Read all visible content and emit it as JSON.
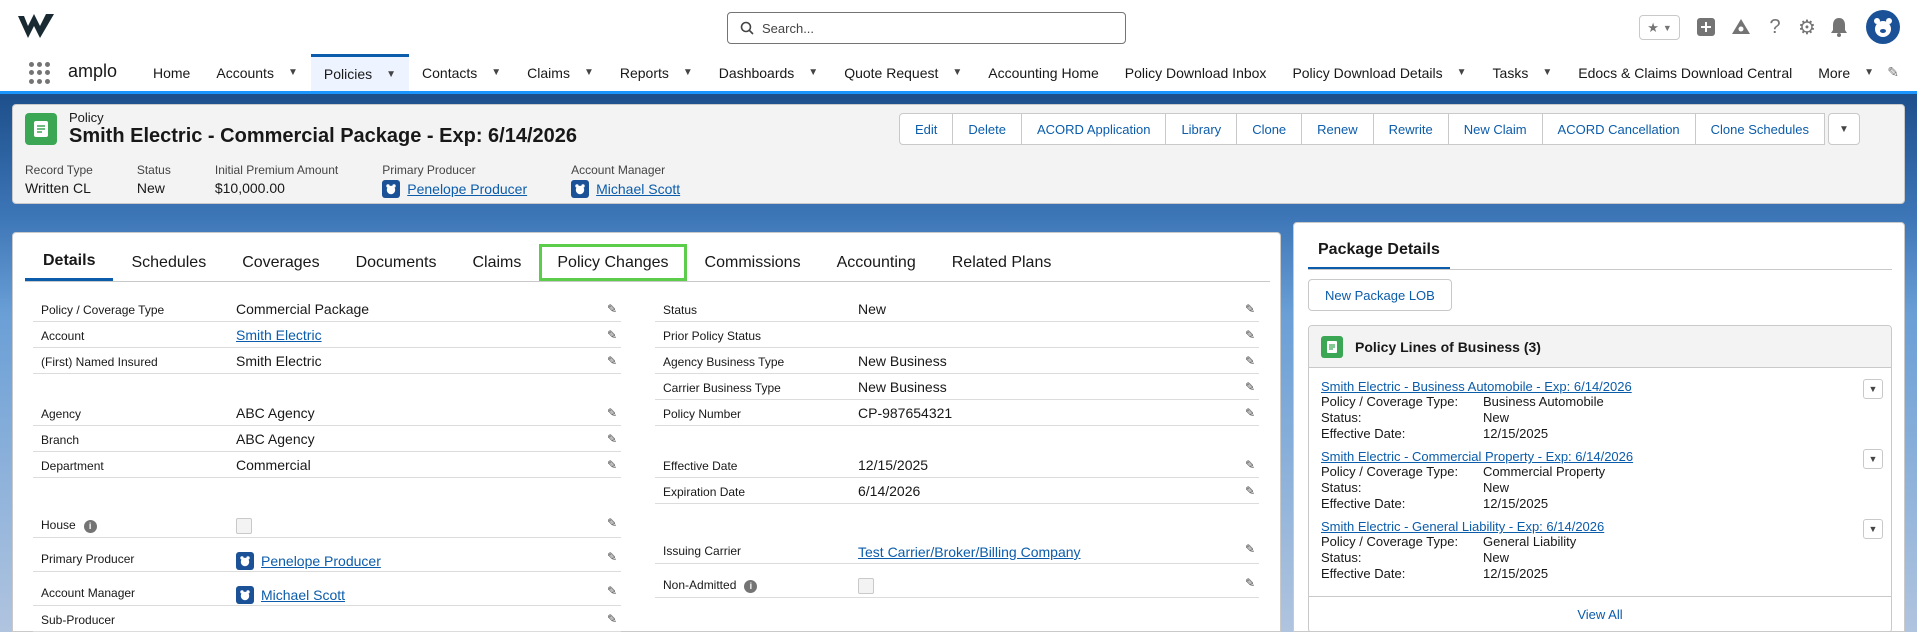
{
  "search": {
    "placeholder": "Search..."
  },
  "app": {
    "name": "amplo"
  },
  "nav": {
    "items": [
      {
        "label": "Home",
        "chevron": false
      },
      {
        "label": "Accounts",
        "chevron": true
      },
      {
        "label": "Policies",
        "chevron": true,
        "active": true
      },
      {
        "label": "Contacts",
        "chevron": true
      },
      {
        "label": "Claims",
        "chevron": true
      },
      {
        "label": "Reports",
        "chevron": true
      },
      {
        "label": "Dashboards",
        "chevron": true
      },
      {
        "label": "Quote Request",
        "chevron": true
      },
      {
        "label": "Accounting Home",
        "chevron": false
      },
      {
        "label": "Policy Download Inbox",
        "chevron": false
      },
      {
        "label": "Policy Download Details",
        "chevron": true
      },
      {
        "label": "Tasks",
        "chevron": true
      },
      {
        "label": "Edocs & Claims Download Central",
        "chevron": false
      },
      {
        "label": "More",
        "chevron": true
      }
    ]
  },
  "record": {
    "object": "Policy",
    "title": "Smith Electric - Commercial Package - Exp: 6/14/2026",
    "actions": [
      "Edit",
      "Delete",
      "ACORD Application",
      "Library",
      "Clone",
      "Renew",
      "Rewrite",
      "New Claim",
      "ACORD Cancellation",
      "Clone Schedules"
    ],
    "highlights": [
      {
        "label": "Record Type",
        "value": "Written CL",
        "user": false
      },
      {
        "label": "Status",
        "value": "New",
        "user": false
      },
      {
        "label": "Initial Premium Amount",
        "value": "$10,000.00",
        "user": false
      },
      {
        "label": "Primary Producer",
        "value": "Penelope Producer",
        "user": true
      },
      {
        "label": "Account Manager",
        "value": "Michael Scott",
        "user": true
      }
    ]
  },
  "tabs": [
    "Details",
    "Schedules",
    "Coverages",
    "Documents",
    "Claims",
    "Policy Changes",
    "Commissions",
    "Accounting",
    "Related Plans"
  ],
  "details": {
    "left": [
      {
        "label": "Policy / Coverage Type",
        "value": "Commercial Package"
      },
      {
        "label": "Account",
        "value": "Smith Electric",
        "link": true
      },
      {
        "label": "(First) Named Insured",
        "value": "Smith Electric",
        "gap": true
      },
      {
        "label": "Agency",
        "value": "ABC Agency"
      },
      {
        "label": "Branch",
        "value": "ABC Agency"
      },
      {
        "label": "Department",
        "value": "Commercial",
        "gap": true
      },
      {
        "label": "House",
        "value": "",
        "checkbox": true,
        "info": true
      },
      {
        "label": "Primary Producer",
        "value": "Penelope Producer",
        "link": true,
        "user": true
      },
      {
        "label": "Account Manager",
        "value": "Michael Scott",
        "link": true,
        "user": true
      },
      {
        "label": "Sub-Producer",
        "value": ""
      }
    ],
    "right": [
      {
        "label": "Status",
        "value": "New"
      },
      {
        "label": "Prior Policy Status",
        "value": ""
      },
      {
        "label": "Agency Business Type",
        "value": "New Business"
      },
      {
        "label": "Carrier Business Type",
        "value": "New Business"
      },
      {
        "label": "Policy Number",
        "value": "CP-987654321",
        "gap": true
      },
      {
        "label": "Effective Date",
        "value": "12/15/2025"
      },
      {
        "label": "Expiration Date",
        "value": "6/14/2026",
        "gap": true
      },
      {
        "label": "Issuing Carrier",
        "value": "Test Carrier/Broker/Billing Company",
        "link": true
      },
      {
        "label": "Non-Admitted",
        "value": "",
        "checkbox": true,
        "info": true
      }
    ]
  },
  "package": {
    "tab": "Package Details",
    "new_button": "New Package LOB",
    "card_title": "Policy Lines of Business (3)",
    "field_labels": {
      "type": "Policy / Coverage Type:",
      "status": "Status:",
      "effective": "Effective Date:"
    },
    "lines": [
      {
        "name": "Smith Electric - Business Automobile - Exp: 6/14/2026",
        "type": "Business Automobile",
        "status": "New",
        "effective": "12/15/2025"
      },
      {
        "name": "Smith Electric - Commercial Property - Exp: 6/14/2026",
        "type": "Commercial Property",
        "status": "New",
        "effective": "12/15/2025"
      },
      {
        "name": "Smith Electric - General Liability - Exp: 6/14/2026",
        "type": "General Liability",
        "status": "New",
        "effective": "12/15/2025"
      }
    ],
    "view_all": "View All"
  }
}
